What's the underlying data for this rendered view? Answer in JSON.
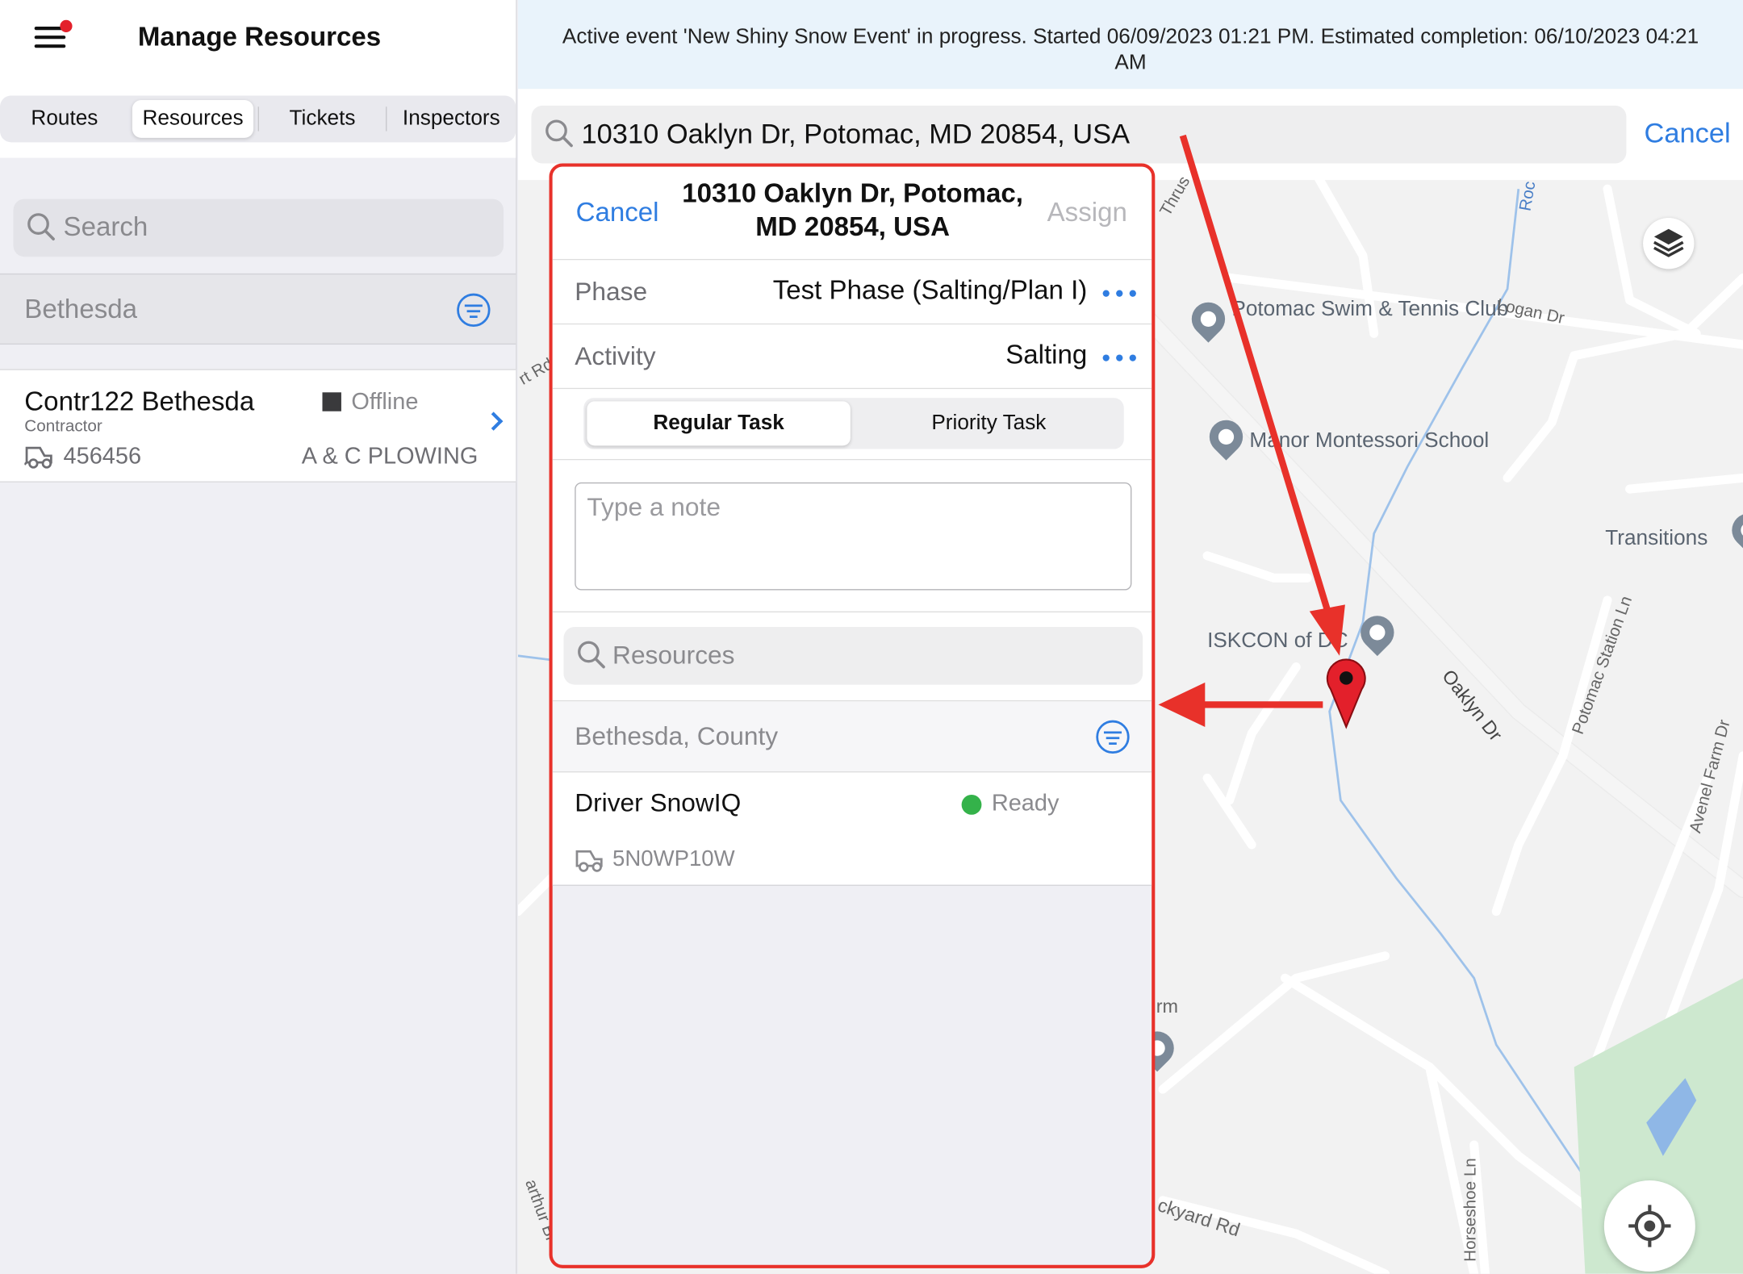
{
  "sidebar": {
    "title": "Manage Resources",
    "tabs": [
      "Routes",
      "Resources",
      "Tickets",
      "Inspectors"
    ],
    "active_tab": "Resources",
    "search_placeholder": "Search",
    "region": "Bethesda",
    "resource": {
      "name": "Contr122 Bethesda",
      "type": "Contractor",
      "status": "Offline",
      "vehicle_id": "456456",
      "company": "A & C PLOWING"
    }
  },
  "banner": {
    "text": "Active event 'New Shiny Snow Event' in progress. Started 06/09/2023 01:21 PM. Estimated completion: 06/10/2023 04:21 AM"
  },
  "address_search": {
    "value": "10310 Oaklyn Dr, Potomac, MD 20854, USA",
    "cancel_label": "Cancel"
  },
  "map": {
    "places": [
      "Potomac Swim & Tennis Club",
      "Manor Montessori School",
      "Transitions",
      "ISKCON of DC"
    ],
    "roads": [
      "Logan Dr",
      "Oaklyn Dr",
      "Potomac Station Ln",
      "Avenel Farm Dr",
      "Horseshoe Ln",
      "ckyard Rd",
      "Thrus",
      "Roc",
      "rt Rd",
      "arthur Bl",
      "rm"
    ]
  },
  "assign_popup": {
    "cancel_label": "Cancel",
    "title": "10310 Oaklyn Dr, Potomac, MD 20854, USA",
    "assign_label": "Assign",
    "phase_label": "Phase",
    "phase_value": "Test Phase (Salting/Plan I)",
    "activity_label": "Activity",
    "activity_value": "Salting",
    "task_types": [
      "Regular Task",
      "Priority Task"
    ],
    "selected_task_type": "Regular Task",
    "note_placeholder": "Type a note",
    "resources_placeholder": "Resources",
    "region": "Bethesda, County",
    "driver": {
      "name": "Driver SnowIQ",
      "status": "Ready",
      "plate": "5N0WP10W"
    }
  },
  "colors": {
    "accent": "#2f7de1",
    "annotation": "#e8312a",
    "ready": "#34b24a",
    "banner_bg": "#e9f3fb"
  }
}
